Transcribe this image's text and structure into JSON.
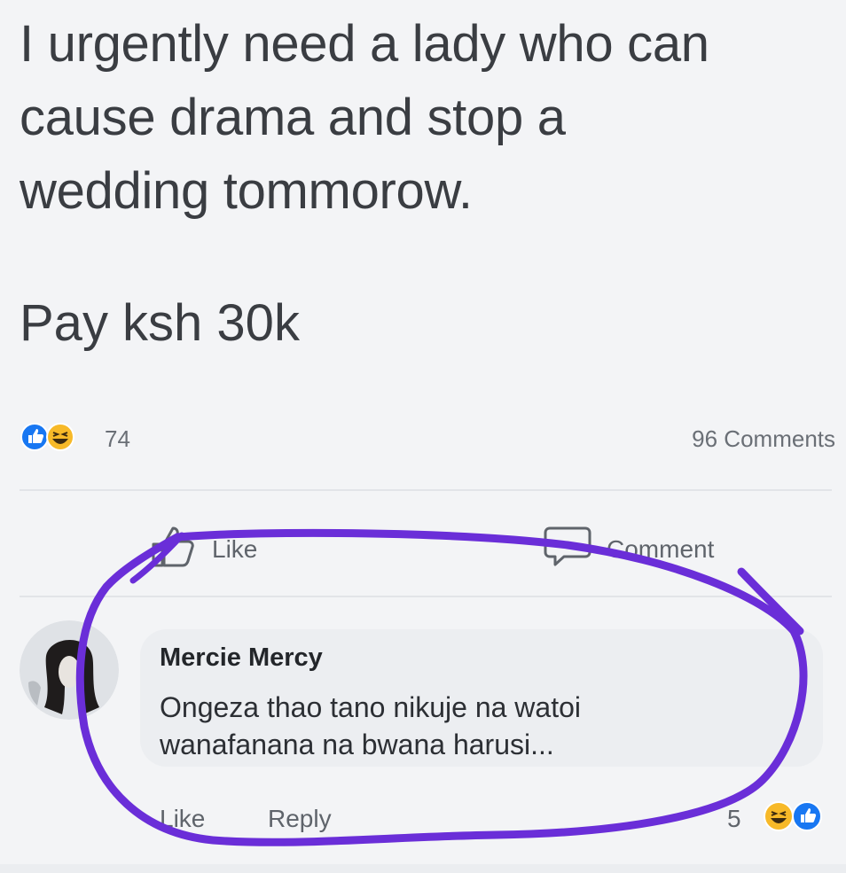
{
  "post": {
    "lines": [
      "I urgently need a lady who can",
      "cause drama and stop a",
      "wedding tommorow."
    ],
    "price_line": "Pay ksh 30k"
  },
  "stats": {
    "reaction_count": "74",
    "comments_label": "96 Comments",
    "reaction_icons": [
      "like-icon",
      "haha-icon"
    ]
  },
  "actions": {
    "like_label": "Like",
    "comment_label": "Comment"
  },
  "comment": {
    "author": "Mercie Mercy",
    "text_lines": [
      "Ongeza thao tano nikuje na watoi",
      "wanafanana na bwana harusi..."
    ],
    "like_label": "Like",
    "reply_label": "Reply",
    "reaction_count": "5",
    "reaction_icons": [
      "haha-icon",
      "like-icon"
    ]
  },
  "colors": {
    "facebook_blue": "#1877f2",
    "haha_yellow": "#f7b928",
    "annotation_purple": "#6a2ed8",
    "background": "#f3f4f6"
  }
}
